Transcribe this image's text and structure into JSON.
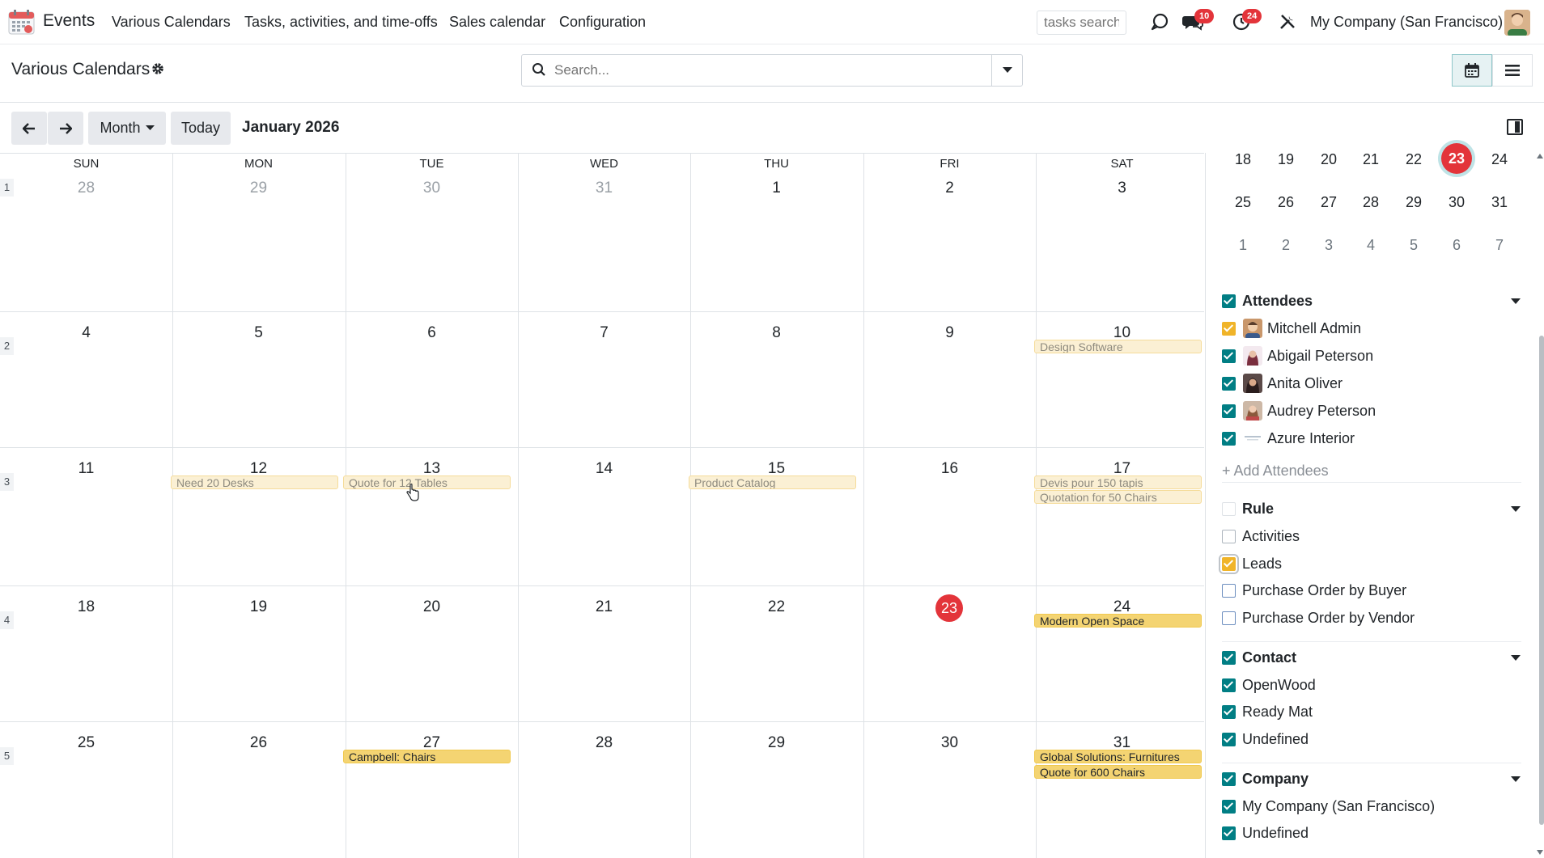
{
  "navbar": {
    "app_name": "Events",
    "menus": [
      "Various Calendars",
      "Tasks, activities, and time-offs",
      "Sales calendar",
      "Configuration"
    ],
    "tasks_search_placeholder": "tasks search",
    "messages_badge": "10",
    "activities_badge": "24",
    "company": "My Company (San Francisco)"
  },
  "control_panel": {
    "title": "Various Calendars",
    "search_placeholder": "Search..."
  },
  "toolbar": {
    "scale_label": "Month",
    "today_label": "Today",
    "period": "January 2026"
  },
  "calendar": {
    "weekdays": [
      "SUN",
      "MON",
      "TUE",
      "WED",
      "THU",
      "FRI",
      "SAT"
    ],
    "week_numbers": [
      "1",
      "2",
      "3",
      "4",
      "5"
    ],
    "weeks": [
      [
        "28",
        "29",
        "30",
        "31",
        "1",
        "2",
        "3"
      ],
      [
        "4",
        "5",
        "6",
        "7",
        "8",
        "9",
        "10"
      ],
      [
        "11",
        "12",
        "13",
        "14",
        "15",
        "16",
        "17"
      ],
      [
        "18",
        "19",
        "20",
        "21",
        "22",
        "23",
        "24"
      ],
      [
        "25",
        "26",
        "27",
        "28",
        "29",
        "30",
        "31"
      ]
    ],
    "today": "23",
    "events": {
      "design_software": "Design Software",
      "need_20_desks": "Need 20 Desks",
      "quote_12_tables": "Quote for 12 Tables",
      "product_catalog": "Product Catalog",
      "devis_150_tapis": "Devis pour 150 tapis",
      "quotation_50_chairs": "Quotation for 50 Chairs",
      "modern_open_space": "Modern Open Space",
      "campbell_chairs": "Campbell: Chairs",
      "global_solutions": "Global Solutions: Furnitures",
      "quote_600_chairs": "Quote for 600 Chairs"
    }
  },
  "mini_calendar": {
    "rows": [
      [
        "18",
        "19",
        "20",
        "21",
        "22",
        "23",
        "24"
      ],
      [
        "25",
        "26",
        "27",
        "28",
        "29",
        "30",
        "31"
      ],
      [
        "1",
        "2",
        "3",
        "4",
        "5",
        "6",
        "7"
      ]
    ]
  },
  "filters": {
    "attendees": {
      "title": "Attendees",
      "items": [
        "Mitchell Admin",
        "Abigail Peterson",
        "Anita Oliver",
        "Audrey Peterson",
        "Azure Interior"
      ],
      "add_label": "+ Add Attendees"
    },
    "rule": {
      "title": "Rule",
      "items": [
        "Activities",
        "Leads",
        "Purchase Order by Buyer",
        "Purchase Order by Vendor"
      ]
    },
    "contact": {
      "title": "Contact",
      "items": [
        "OpenWood",
        "Ready Mat",
        "Undefined"
      ]
    },
    "company": {
      "title": "Company",
      "items": [
        "My Company (San Francisco)",
        "Undefined"
      ]
    }
  },
  "colors": {
    "accent": "#017e84",
    "today": "#e3343a",
    "event_solid": "#f4d472",
    "event_faded": "#fbf0d4"
  }
}
